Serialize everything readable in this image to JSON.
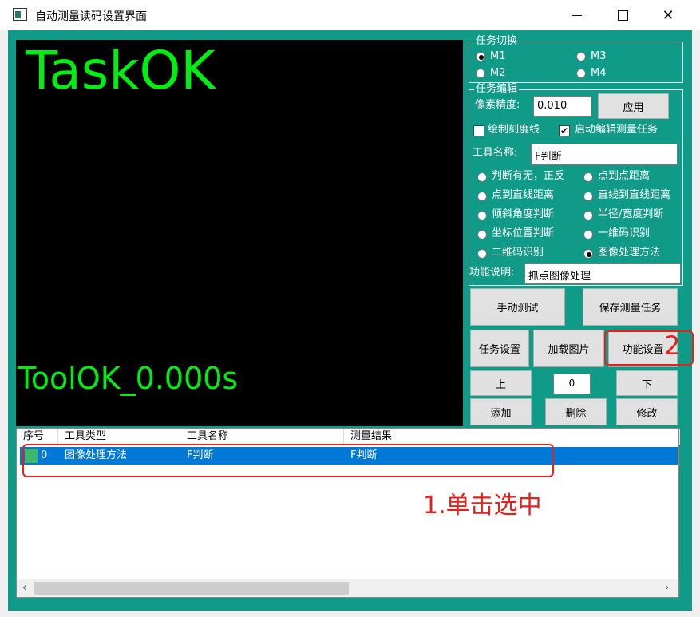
{
  "window": {
    "title": "自动测量读码设置界面",
    "controls": [
      "minimize",
      "maximize",
      "close"
    ]
  },
  "display": {
    "task_status": "TaskOK",
    "tool_status": "ToolOK_0.000s",
    "text_color": "#00ee11"
  },
  "task_switch": {
    "title": "任务切换",
    "options": [
      {
        "label": "M1",
        "selected": true
      },
      {
        "label": "M3",
        "selected": false
      },
      {
        "label": "M2",
        "selected": false
      },
      {
        "label": "M4",
        "selected": false
      }
    ]
  },
  "task_edit": {
    "title": "任务编辑",
    "pixel_precision_label": "像素精度:",
    "pixel_precision_value": "0.010",
    "apply_label": "应用",
    "draw_scale_label": "绘制刻度线",
    "draw_scale_checked": false,
    "enable_edit_label": "启动编辑测量任务",
    "enable_edit_checked": true,
    "tool_name_label": "工具名称:",
    "tool_name_value": "F判断",
    "tool_types": [
      {
        "label": "判断有无，正反",
        "selected": false
      },
      {
        "label": "点到点距离",
        "selected": false
      },
      {
        "label": "点到直线距离",
        "selected": false
      },
      {
        "label": "直线到直线距离",
        "selected": false
      },
      {
        "label": "倾斜角度判断",
        "selected": false
      },
      {
        "label": "半径/宽度判断",
        "selected": false
      },
      {
        "label": "坐标位置判断",
        "selected": false
      },
      {
        "label": "一维码识别",
        "selected": false
      },
      {
        "label": "二维码识别",
        "selected": false
      },
      {
        "label": "图像处理方法",
        "selected": true
      }
    ],
    "function_desc_label": "功能说明:",
    "function_desc_value": "抓点图像处理"
  },
  "buttons": {
    "manual_test": "手动测试",
    "save_task": "保存测量任务",
    "task_settings": "任务设置",
    "load_image": "加载图片",
    "function_settings": "功能设置",
    "up": "上",
    "index_value": "0",
    "down": "下",
    "add": "添加",
    "delete": "删除",
    "modify": "修改"
  },
  "tool_list": {
    "columns": [
      "序号",
      "工具类型",
      "工具名称",
      "测量结果"
    ],
    "rows": [
      {
        "index": "0",
        "type": "图像处理方法",
        "name": "F判断",
        "result": "F判断",
        "selected": true
      }
    ]
  },
  "annotations": {
    "step1": "1.单击选中",
    "step2": "2",
    "color": "#e8201a"
  },
  "colors": {
    "panel_bg": "#109a88",
    "selection": "#0078d7"
  }
}
